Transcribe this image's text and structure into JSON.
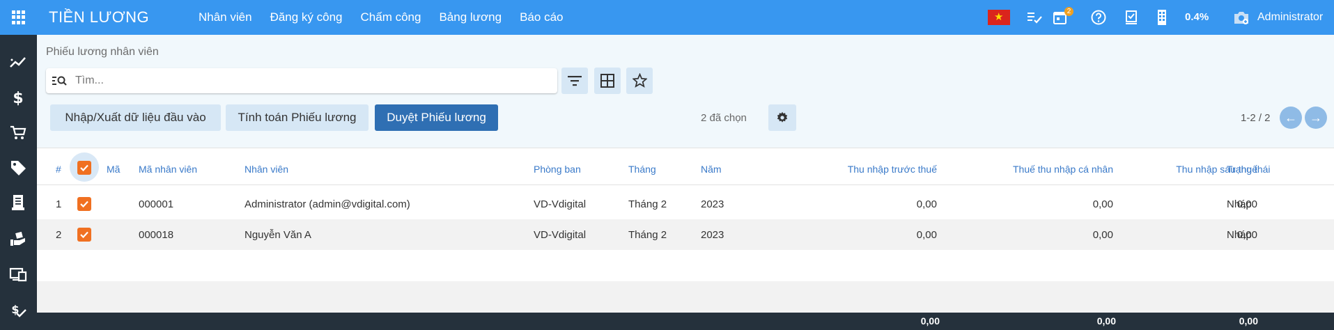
{
  "app": {
    "title": "TIỀN LƯƠNG"
  },
  "menu": [
    "Nhân viên",
    "Đăng ký công",
    "Chấm công",
    "Bảng lương",
    "Báo cáo"
  ],
  "systray": {
    "activity_count": "2",
    "percent": "0.4%",
    "user": "Administrator"
  },
  "colors": {
    "topbar": "#3897f0",
    "sidebar": "#25313c",
    "primary": "#2f6fb3",
    "checkbox": "#f07021",
    "header_text": "#3a7ac9"
  },
  "sidebar_icons": [
    "trend-icon",
    "dollar-icon",
    "cart-icon",
    "tag-icon",
    "receipt-icon",
    "hand-coins-icon",
    "devices-icon",
    "salary-check-icon"
  ],
  "breadcrumb": "Phiếu lương nhân viên",
  "search": {
    "placeholder": "Tìm..."
  },
  "actions": {
    "import_export": "Nhập/Xuất dữ liệu đầu vào",
    "compute": "Tính toán Phiếu lương",
    "approve": "Duyệt Phiếu lương",
    "selected": "2 đã chọn"
  },
  "pager": {
    "value": "1-2 / 2"
  },
  "table": {
    "headers": {
      "index": "#",
      "code": "Mã",
      "employee_code": "Mã nhân viên",
      "employee": "Nhân viên",
      "department": "Phòng ban",
      "month": "Tháng",
      "year": "Năm",
      "gross": "Thu nhập trước thuế",
      "tax": "Thuế thu nhập cá nhân",
      "net": "Thu nhập sau thuế",
      "status": "Trạng thái"
    },
    "rows": [
      {
        "index": "1",
        "employee_code": "000001",
        "employee": "Administrator (admin@vdigital.com)",
        "department": "VD-Vdigital",
        "month": "Tháng 2",
        "year": "2023",
        "gross": "0,00",
        "tax": "0,00",
        "net": "0,00",
        "status": "Nháp"
      },
      {
        "index": "2",
        "employee_code": "000018",
        "employee": "Nguyễn Văn A",
        "department": "VD-Vdigital",
        "month": "Tháng 2",
        "year": "2023",
        "gross": "0,00",
        "tax": "0,00",
        "net": "0,00",
        "status": "Nháp"
      }
    ],
    "totals": {
      "gross": "0,00",
      "tax": "0,00",
      "net": "0,00"
    }
  }
}
